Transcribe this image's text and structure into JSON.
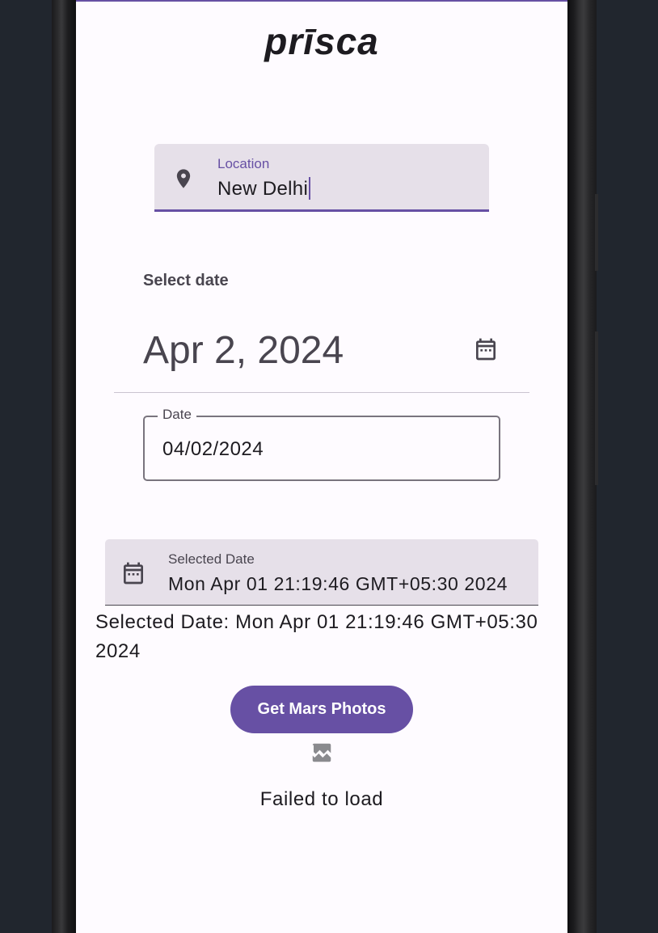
{
  "app": {
    "logo_text": "prīsca"
  },
  "location": {
    "label": "Location",
    "value": "New Delhi",
    "icon": "location-pin-icon"
  },
  "date_picker": {
    "title": "Select date",
    "headline": "Apr 2, 2024",
    "toggle_icon": "calendar-icon",
    "input_label": "Date",
    "input_value": "04/02/2024"
  },
  "selected_field": {
    "label": "Selected Date",
    "value": "Mon Apr 01 21:19:46 GMT+05:30 2024",
    "icon": "calendar-icon"
  },
  "selected_text": "Selected Date: Mon Apr 01 21:19:46 GMT+05:30 2024",
  "action": {
    "button_label": "Get Mars Photos"
  },
  "result": {
    "icon": "broken-image-icon",
    "message": "Failed to load"
  },
  "colors": {
    "primary": "#6750a4",
    "surface": "#fefbff",
    "field_background": "#e6e0e9",
    "on_surface": "#1d1b20",
    "on_surface_variant": "#49454f"
  }
}
